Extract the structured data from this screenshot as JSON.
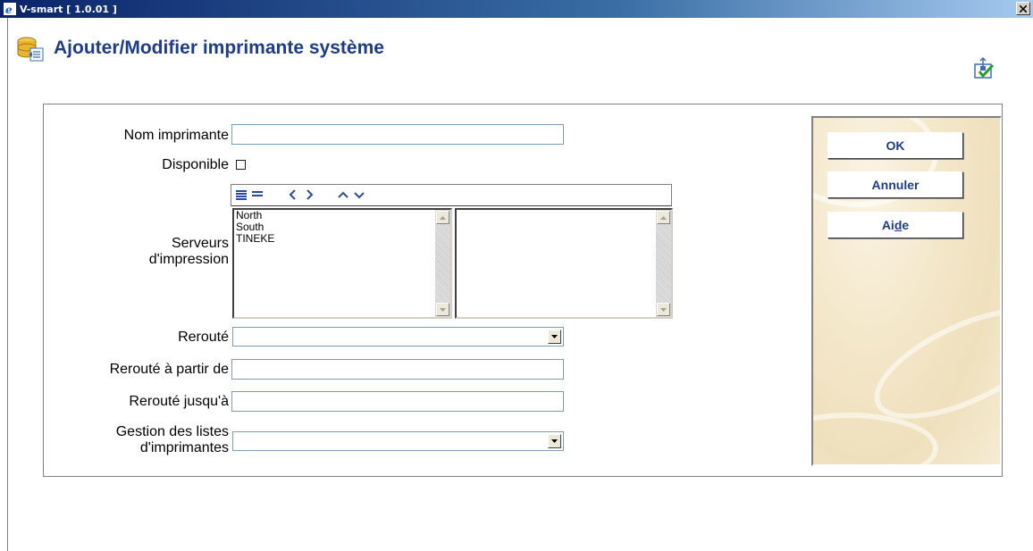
{
  "window": {
    "title": "V-smart [ 1.0.01 ]"
  },
  "page": {
    "title": "Ajouter/Modifier imprimante système"
  },
  "form": {
    "printer_name_label": "Nom imprimante",
    "printer_name_value": "",
    "available_label": "Disponible",
    "available_checked": false,
    "servers_label_line1": "Serveurs",
    "servers_label_line2": "d'impression",
    "servers_available": [
      "North",
      "South",
      "TINEKE"
    ],
    "servers_selected": [],
    "rerouted_label": "Rerouté",
    "rerouted_value": "",
    "rerouted_from_label": "Rerouté à partir de",
    "rerouted_from_value": "",
    "rerouted_until_label": "Rerouté jusqu'à",
    "rerouted_until_value": "",
    "list_mgmt_label_line1": "Gestion des listes",
    "list_mgmt_label_line2": "d'imprimantes",
    "list_mgmt_value": ""
  },
  "buttons": {
    "ok": "OK",
    "cancel": "Annuler",
    "help_pre": "Ai",
    "help_u": "d",
    "help_post": "e"
  },
  "icons": {
    "app": "ie-icon",
    "header": "database-edit-icon",
    "corner": "workflow-check-icon"
  },
  "colors": {
    "title_blue": "#1f3c88",
    "titlebar": "#0a246a",
    "panel_bg": "#f3e6c7"
  }
}
